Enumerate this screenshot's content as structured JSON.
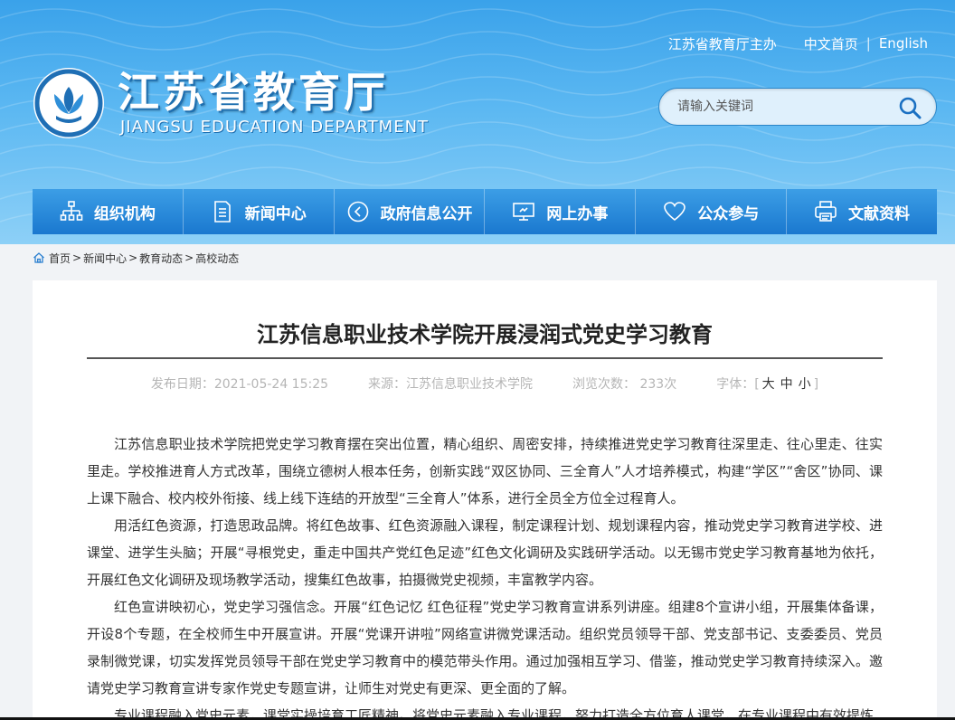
{
  "header": {
    "toplinks": {
      "host": "江苏省教育厅主办",
      "chinese": "中文首页",
      "separator": "|",
      "english": "English"
    },
    "title": "江苏省教育厅",
    "subtitle": "JIANGSU EDUCATION DEPARTMENT",
    "search": {
      "placeholder": "请输入关键词"
    }
  },
  "nav": [
    {
      "label": "组织机构",
      "icon": "org-chart-icon"
    },
    {
      "label": "新闻中心",
      "icon": "document-icon"
    },
    {
      "label": "政府信息公开",
      "icon": "info-play-icon"
    },
    {
      "label": "网上办事",
      "icon": "monitor-icon"
    },
    {
      "label": "公众参与",
      "icon": "heart-icon"
    },
    {
      "label": "文献资料",
      "icon": "printer-icon"
    }
  ],
  "breadcrumb": {
    "items": [
      "首页",
      "新闻中心",
      "教育动态",
      "高校动态"
    ],
    "sep": ">"
  },
  "article": {
    "title": "江苏信息职业技术学院开展浸润式党史学习教育",
    "meta": {
      "date": "发布日期：2021-05-24 15:25",
      "source": "来源：江苏信息职业技术学院",
      "views": "浏览次数： 233次",
      "fontsize_label": "字体：[",
      "fontsize_close": "]",
      "fontsize_options": [
        "大",
        "中",
        "小"
      ]
    },
    "paragraphs": [
      "江苏信息职业技术学院把党史学习教育摆在突出位置，精心组织、周密安排，持续推进党史学习教育往深里走、往心里走、往实里走。学校推进育人方式改革，围绕立德树人根本任务，创新实践“双区协同、三全育人”人才培养模式，构建“学区”“舍区”协同、课上课下融合、校内校外衔接、线上线下连结的开放型“三全育人”体系，进行全员全方位全过程育人。",
      "用活红色资源，打造思政品牌。将红色故事、红色资源融入课程，制定课程计划、规划课程内容，推动党史学习教育进学校、进课堂、进学生头脑；开展“寻根党史，重走中国共产党红色足迹”红色文化调研及实践研学活动。以无锡市党史学习教育基地为依托，开展红色文化调研及现场教学活动，搜集红色故事，拍摄微党史视频，丰富教学内容。",
      "红色宣讲映初心，党史学习强信念。开展“红色记忆 红色征程”党史学习教育宣讲系列讲座。组建8个宣讲小组，开展集体备课，开设8个专题，在全校师生中开展宣讲。开展“党课开讲啦”网络宣讲微党课活动。组织党员领导干部、党支部书记、支委委员、党员录制微党课，切实发挥党员领导干部在党史学习教育中的模范带头作用。通过加强相互学习、借鉴，推动党史学习教育持续深入。邀请党史学习教育宣讲专家作党史专题宣讲，让师生对党史有更深、更全面的了解。",
      "专业课程融入党史元素，课堂实操培育工匠精神。将党史元素融入专业课程，努力打造全方位育人课堂，在专业课程中有效提炼"
    ]
  }
}
